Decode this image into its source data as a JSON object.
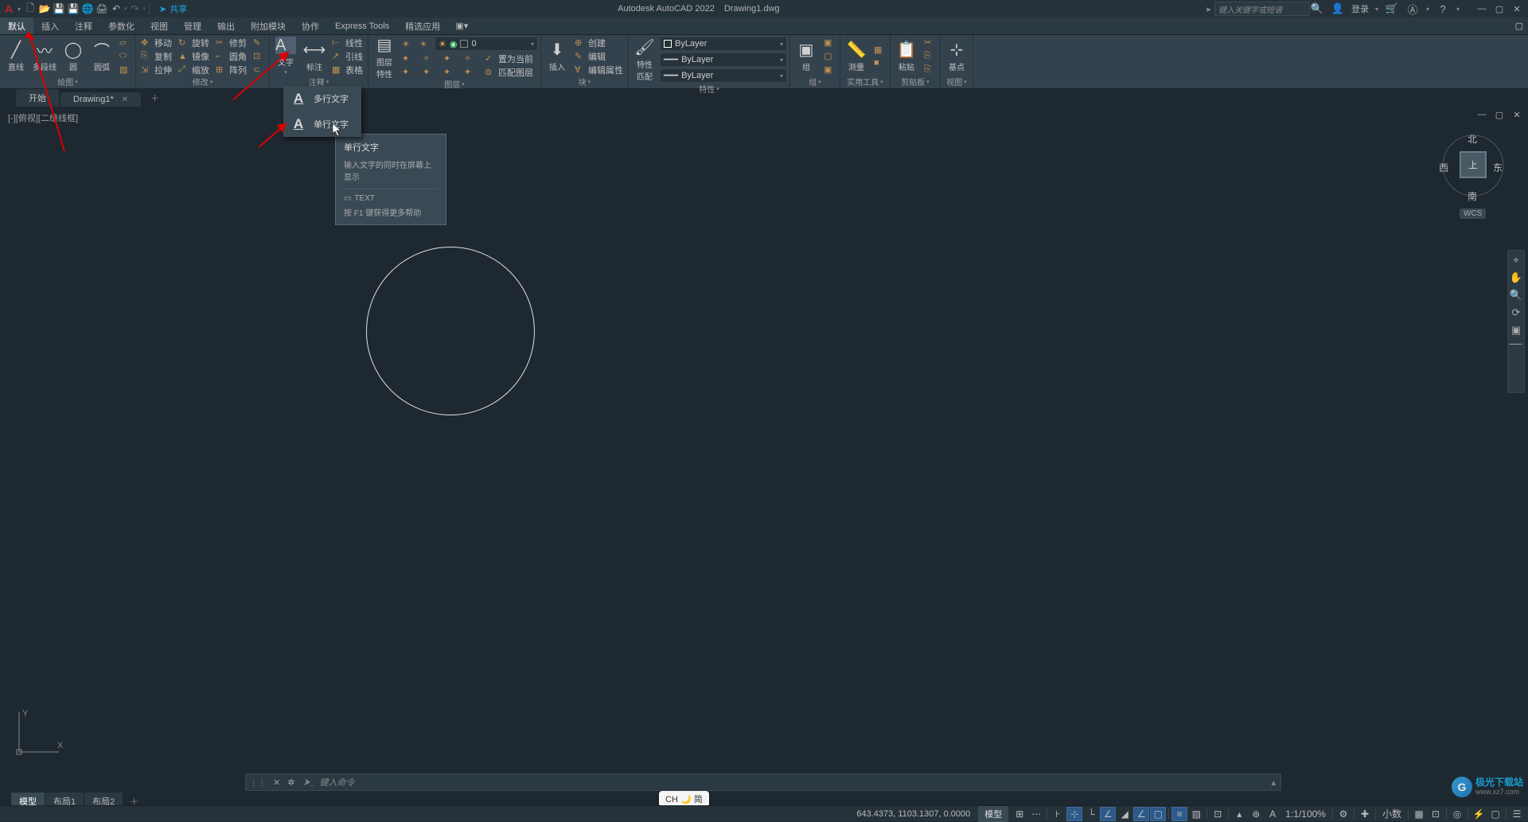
{
  "title": {
    "app": "Autodesk AutoCAD 2022",
    "file": "Drawing1.dwg"
  },
  "search": {
    "placeholder": "键入关键字或短语"
  },
  "login": "登录",
  "share": "共享",
  "menu_tabs": [
    "默认",
    "插入",
    "注释",
    "参数化",
    "视图",
    "管理",
    "输出",
    "附加模块",
    "协作",
    "Express Tools",
    "精选应用"
  ],
  "draw": {
    "l1": "直线",
    "l2": "多段线",
    "l3": "圆",
    "l4": "圆弧",
    "panel": "绘图"
  },
  "modify": {
    "move": "移动",
    "rotate": "旋转",
    "trim": "修剪",
    "copy": "复制",
    "mirror": "镜像",
    "fillet": "圆角",
    "stretch": "拉伸",
    "scale": "缩放",
    "array": "阵列",
    "panel": "修改"
  },
  "annot": {
    "text": "文字",
    "dim": "标注",
    "linear": "线性",
    "leader": "引线",
    "table": "表格",
    "panel": "注释"
  },
  "layer": {
    "props": "图层\n特性",
    "panel": "图层",
    "combo_value": "0",
    "match": "匹配图层",
    "current": "置为当前"
  },
  "block": {
    "insert": "插入",
    "create": "创建",
    "edit": "编辑",
    "editattr": "编辑属性",
    "panel": "块"
  },
  "props": {
    "gate": "特性\n匹配",
    "bylayer": "ByLayer",
    "panel": "特性"
  },
  "group": {
    "label": "组",
    "panel": "组"
  },
  "util": {
    "measure": "测量",
    "panel": "实用工具"
  },
  "clip": {
    "paste": "粘贴",
    "panel": "剪贴板"
  },
  "view": {
    "base": "基点",
    "panel": "视图"
  },
  "file_tabs": {
    "start": "开始",
    "drawing": "Drawing1*"
  },
  "viewport_label": "[-][俯视][二维线框]",
  "viewcube": {
    "n": "北",
    "s": "南",
    "e": "东",
    "w": "西",
    "top": "上",
    "wcs": "WCS"
  },
  "text_menu": {
    "multi": "多行文字",
    "single": "单行文字"
  },
  "tooltip": {
    "title": "单行文字",
    "desc": "输入文字的同时在屏幕上显示",
    "cmd": "TEXT",
    "help": "按 F1 键获得更多帮助"
  },
  "cmd": {
    "placeholder": "键入命令"
  },
  "layout_tabs": [
    "模型",
    "布局1",
    "布局2"
  ],
  "status": {
    "coords": "643.4373, 1103.1307, 0.0000",
    "model": "模型",
    "scale": "1:1/100%",
    "decimal": "小数",
    "ime": "CH 🌙 简"
  },
  "ucs": {
    "x": "X",
    "y": "Y"
  },
  "watermark": {
    "l1": "极光下载站",
    "l2": "www.xz7.com"
  }
}
